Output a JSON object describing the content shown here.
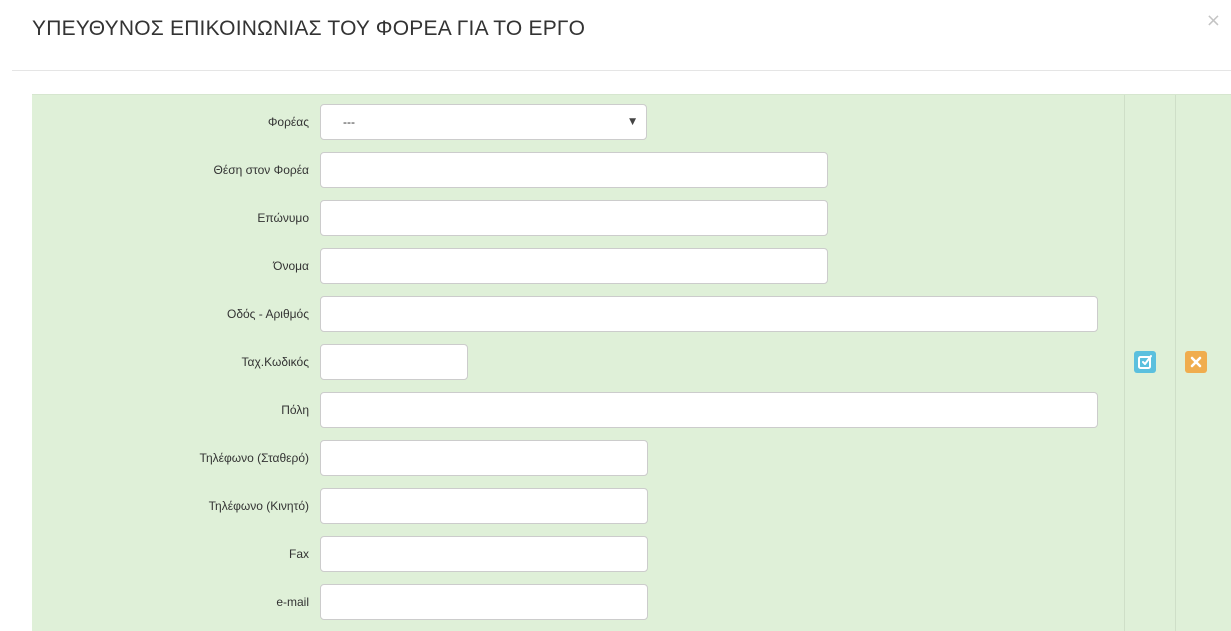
{
  "modal": {
    "title": "ΥΠΕΥΘΥΝΟΣ ΕΠΙΚΟΙΝΩΝΙΑΣ ΤΟΥ ΦΟΡΕΑ ΓΙΑ ΤΟ ΕΡΓΟ",
    "close_symbol": "×"
  },
  "form": {
    "agency": {
      "label": "Φορέας",
      "selected": "---"
    },
    "position": {
      "label": "Θέση στον Φορέα",
      "value": ""
    },
    "surname": {
      "label": "Επώνυμο",
      "value": ""
    },
    "name": {
      "label": "Όνομα",
      "value": ""
    },
    "street": {
      "label": "Οδός - Αριθμός",
      "value": ""
    },
    "postcode": {
      "label": "Ταχ.Κωδικός",
      "value": ""
    },
    "city": {
      "label": "Πόλη",
      "value": ""
    },
    "phone_landline": {
      "label": "Τηλέφωνο (Σταθερό)",
      "value": ""
    },
    "phone_mobile": {
      "label": "Τηλέφωνο (Κινητό)",
      "value": ""
    },
    "fax": {
      "label": "Fax",
      "value": ""
    },
    "email": {
      "label": "e-mail",
      "value": ""
    }
  },
  "actions": {
    "edit_icon": "edit-icon",
    "delete_icon": "close-icon",
    "edit_color": "#5bc0de",
    "delete_color": "#f0ad4e"
  },
  "colors": {
    "panel_background": "#dff0d8"
  }
}
